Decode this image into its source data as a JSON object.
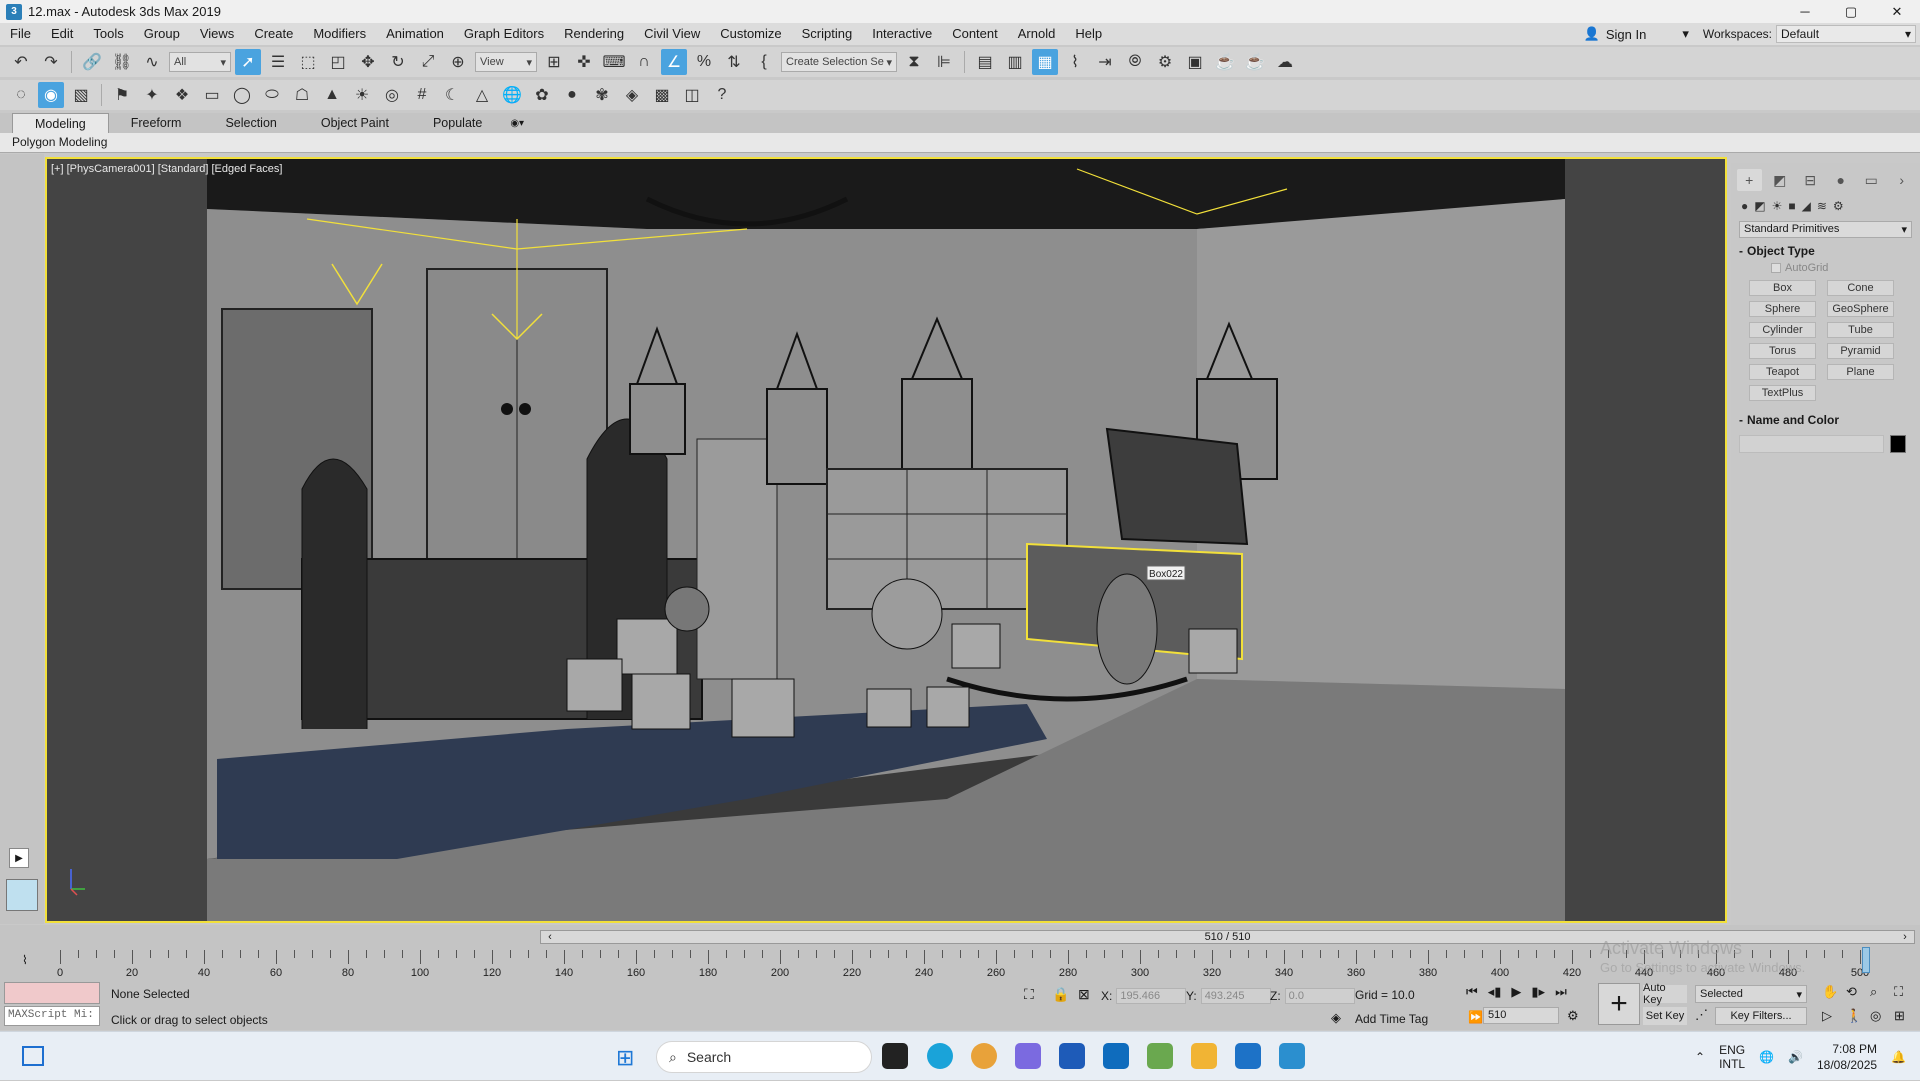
{
  "window": {
    "title": "12.max - Autodesk 3ds Max 2019",
    "app_icon": "3",
    "minimize": "─",
    "maximize": "▢",
    "close": "✕"
  },
  "menu": {
    "items": [
      "File",
      "Edit",
      "Tools",
      "Group",
      "Views",
      "Create",
      "Modifiers",
      "Animation",
      "Graph Editors",
      "Rendering",
      "Civil View",
      "Customize",
      "Scripting",
      "Interactive",
      "Content",
      "Arnold",
      "Help"
    ],
    "sign_in": "Sign In",
    "workspaces_label": "Workspaces:",
    "workspace_value": "Default"
  },
  "toolbar": {
    "selection_filter": "All",
    "ref_coord": "View",
    "named_selection": "Create Selection Se"
  },
  "ribbon": {
    "tabs": [
      "Modeling",
      "Freeform",
      "Selection",
      "Object Paint",
      "Populate"
    ],
    "active_tab": "Modeling",
    "panel_label": "Polygon Modeling"
  },
  "viewport": {
    "label": "[+] [PhysCamera001] [Standard] [Edged Faces]",
    "selected_object_tag": "Box022",
    "selection_color": "#f2e03a"
  },
  "command_panel": {
    "category": "Standard Primitives",
    "object_type_title": "Object Type",
    "autogrid": "AutoGrid",
    "primitives": [
      "Box",
      "Cone",
      "Sphere",
      "GeoSphere",
      "Cylinder",
      "Tube",
      "Torus",
      "Pyramid",
      "Teapot",
      "Plane",
      "TextPlus"
    ],
    "name_color_title": "Name and Color"
  },
  "timeline": {
    "frame_display": "510 / 510",
    "ticks": [
      "0",
      "20",
      "40",
      "60",
      "80",
      "100",
      "120",
      "140",
      "160",
      "180",
      "200",
      "220",
      "240",
      "260",
      "280",
      "300",
      "320",
      "340",
      "360",
      "380",
      "400",
      "420",
      "440",
      "460",
      "480",
      "500"
    ]
  },
  "status": {
    "selection": "None Selected",
    "prompt": "Click or drag to select objects",
    "maxscript": "MAXScript Mi:",
    "x_label": "X:",
    "x_value": "195.466",
    "y_label": "Y:",
    "y_value": "493.245",
    "z_label": "Z:",
    "z_value": "0.0",
    "grid": "Grid = 10.0",
    "add_time_tag": "Add Time Tag",
    "auto_key": "Auto Key",
    "set_key": "Set Key",
    "key_mode": "Selected",
    "key_filters": "Key Filters...",
    "current_frame": "510"
  },
  "taskbar": {
    "search": "Search",
    "lang_top": "ENG",
    "lang_bottom": "INTL",
    "time": "7:08 PM",
    "date": "18/08/2025"
  },
  "watermark": {
    "line1": "Activate Windows",
    "line2": "Go to Settings to activate Windows."
  }
}
